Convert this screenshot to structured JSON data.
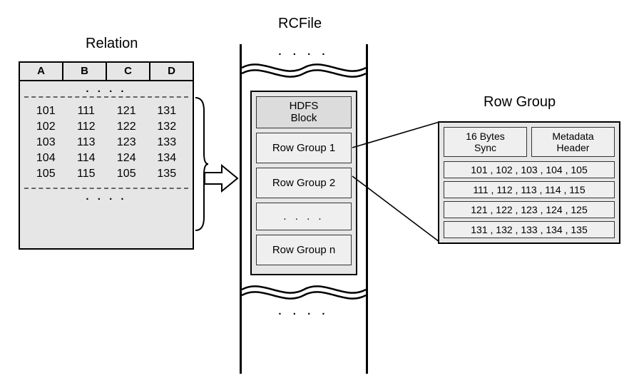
{
  "titles": {
    "relation": "Relation",
    "rcfile": "RCFile",
    "rowgroup": "Row Group"
  },
  "relation": {
    "headers": [
      "A",
      "B",
      "C",
      "D"
    ],
    "ellipsis": ". . . .",
    "rows": [
      [
        "101",
        "111",
        "121",
        "131"
      ],
      [
        "102",
        "112",
        "122",
        "132"
      ],
      [
        "103",
        "113",
        "123",
        "133"
      ],
      [
        "104",
        "114",
        "124",
        "134"
      ],
      [
        "105",
        "115",
        "105",
        "135"
      ]
    ]
  },
  "rcfile": {
    "top_ellipsis": ". . . .",
    "hdfs_label": "HDFS\nBlock",
    "groups": {
      "g1": "Row Group 1",
      "g2": "Row Group 2",
      "ellipsis": ". . . .",
      "gn": "Row Group n"
    },
    "bot_ellipsis": ". . . ."
  },
  "rowgroup": {
    "sync": "16 Bytes\nSync",
    "meta": "Metadata\nHeader",
    "rows": [
      "101 , 102 , 103 , 104 , 105",
      "111 , 112 , 113 , 114 , 115",
      "121 , 122 , 123 , 124 , 125",
      "131 , 132 , 133 , 134 , 135"
    ]
  }
}
